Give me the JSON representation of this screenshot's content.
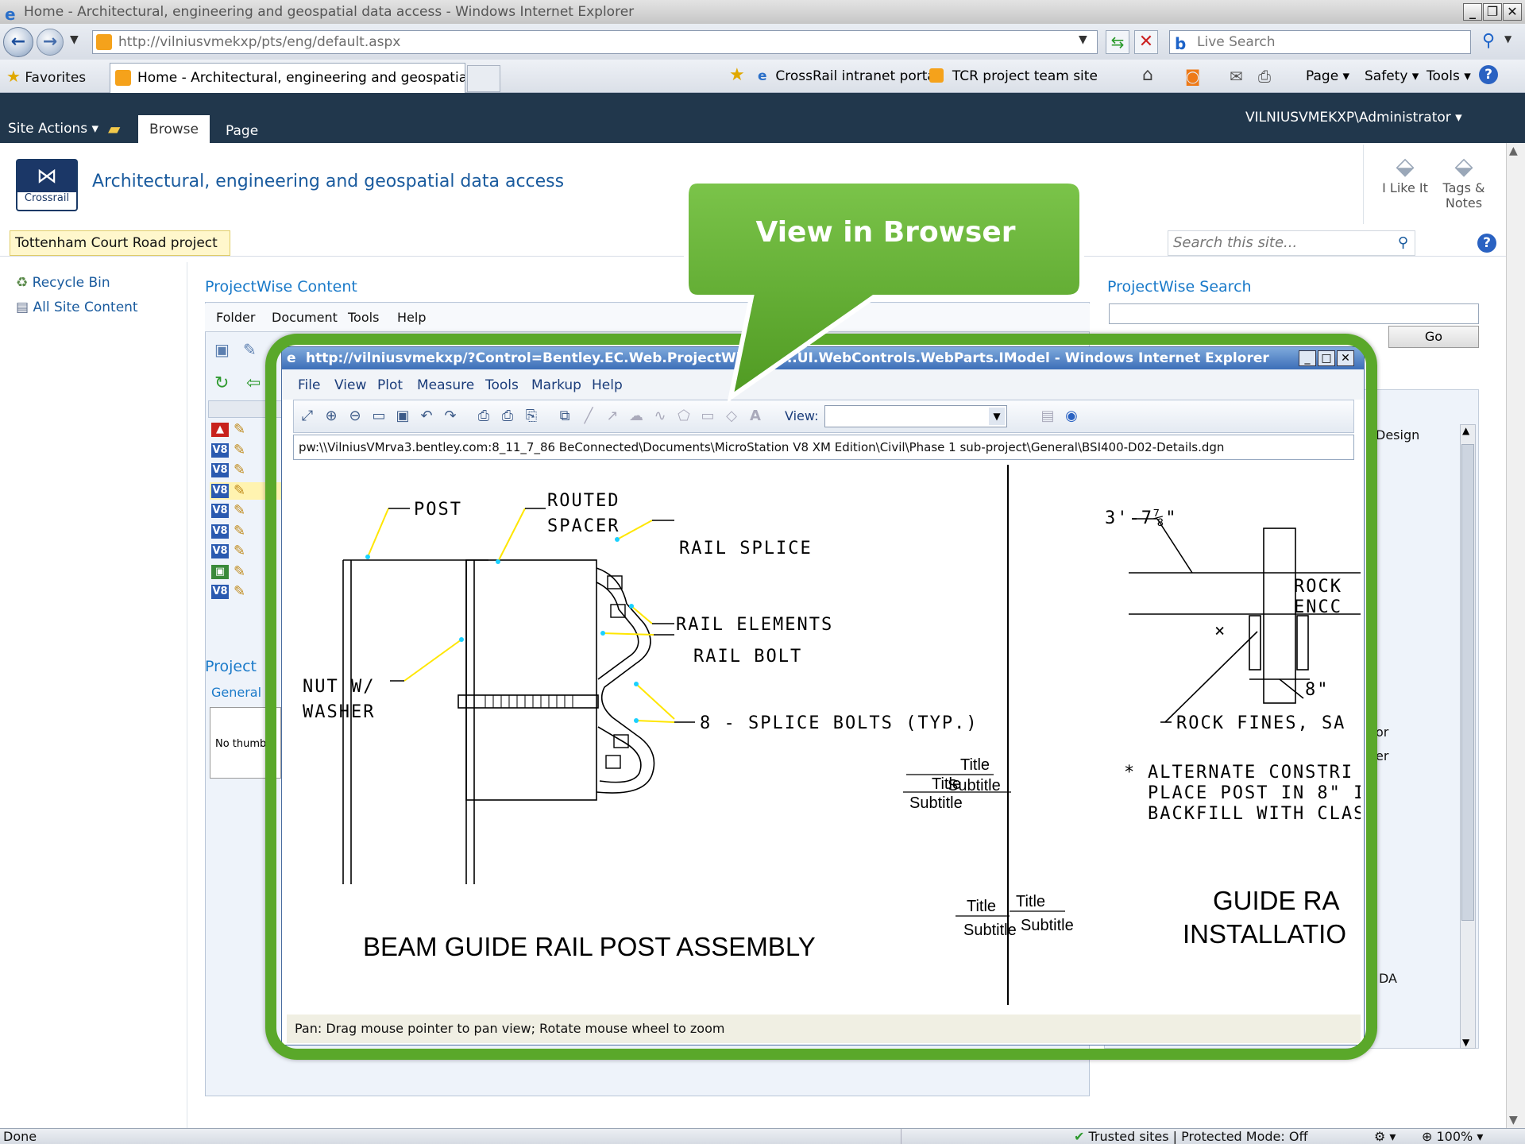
{
  "browser": {
    "window_title": "Home - Architectural, engineering and geospatial data access - Windows Internet Explorer",
    "address": "http://vilniusvmekxp/pts/eng/default.aspx",
    "search_placeholder": "Live Search",
    "favorites_label": "Favorites",
    "tab_title": "Home - Architectural, engineering and geospatial data...",
    "links": [
      "CrossRail intranet portal",
      "TCR project team site"
    ],
    "commands": [
      "Page",
      "Safety",
      "Tools"
    ]
  },
  "sharepoint": {
    "site_actions": "Site Actions",
    "ribbon_tabs": [
      "Browse",
      "Page"
    ],
    "user": "VILNIUSVMEKXP\\Administrator",
    "logo_text": "Crossrail",
    "site_title": "Architectural, engineering and geospatial data access",
    "breadcrumb": "Tottenham Court Road project",
    "search_placeholder": "Search this site...",
    "i_like_it": "I Like It",
    "tags_notes": [
      "Tags &",
      "Notes"
    ],
    "quick_launch": [
      "Recycle Bin",
      "All Site Content"
    ],
    "pw_content_title": "ProjectWise Content",
    "pw_menu": [
      "Folder",
      "Document",
      "Tools",
      "Help"
    ],
    "project_title": "Project",
    "general_tab": "General",
    "no_thumb": "No thumb",
    "pw_search_title": "ProjectWise Search",
    "go_button": "Go",
    "right_fragments": [
      "Design",
      "or",
      "er",
      "DA"
    ]
  },
  "callout": {
    "text": "View in Browser"
  },
  "viewer": {
    "title": "http://vilniusvmekxp/?Control=Bentley.EC.Web.ProjectWise.Sa...UI.WebControls.WebParts.IModel - Windows Internet Explorer",
    "menu": [
      "File",
      "View",
      "Plot",
      "Measure",
      "Tools",
      "Markup",
      "Help"
    ],
    "view_label": "View:",
    "path": "pw:\\\\VilniusVMrva3.bentley.com:8_11_7_86 BeConnected\\Documents\\MicroStation V8 XM Edition\\Civil\\Phase 1 sub-project\\General\\BSI400-D02-Details.dgn",
    "status": "Pan: Drag mouse pointer to pan view; Rotate mouse wheel to zoom"
  },
  "drawing": {
    "post": "POST",
    "routed": "ROUTED",
    "spacer": "SPACER",
    "rail_splice": "RAIL SPLICE",
    "rail_elements": "RAIL ELEMENTS",
    "rail_bolt": "RAIL BOLT",
    "nut": "NUT W/",
    "washer": "WASHER",
    "splice_bolts": "8 - SPLICE BOLTS (TYP.)",
    "dim_top": "3'-7⅞\"",
    "rock": "ROCK",
    "enco": "ENCC",
    "eight_in": "8\"",
    "rock_fines": "ROCK FINES, SA",
    "note": [
      "ALTERNATE CONSTRI",
      "PLACE POST IN 8\" I",
      "BACKFILL WITH CLAS"
    ],
    "heading_left": "BEAM GUIDE RAIL POST ASSEMBLY",
    "heading_right": [
      "GUIDE RA",
      "INSTALLATIO"
    ],
    "title_word": "Title",
    "subtitle_word": "Subtitle"
  },
  "status": {
    "left": "Done",
    "zone": "Trusted sites | Protected Mode: Off",
    "zoom": "100%"
  },
  "colors": {
    "ribbon": "#21374c",
    "link_blue": "#1a5b9e",
    "callout_green": "#5aa82a",
    "frame_green": "#5aa82a"
  }
}
